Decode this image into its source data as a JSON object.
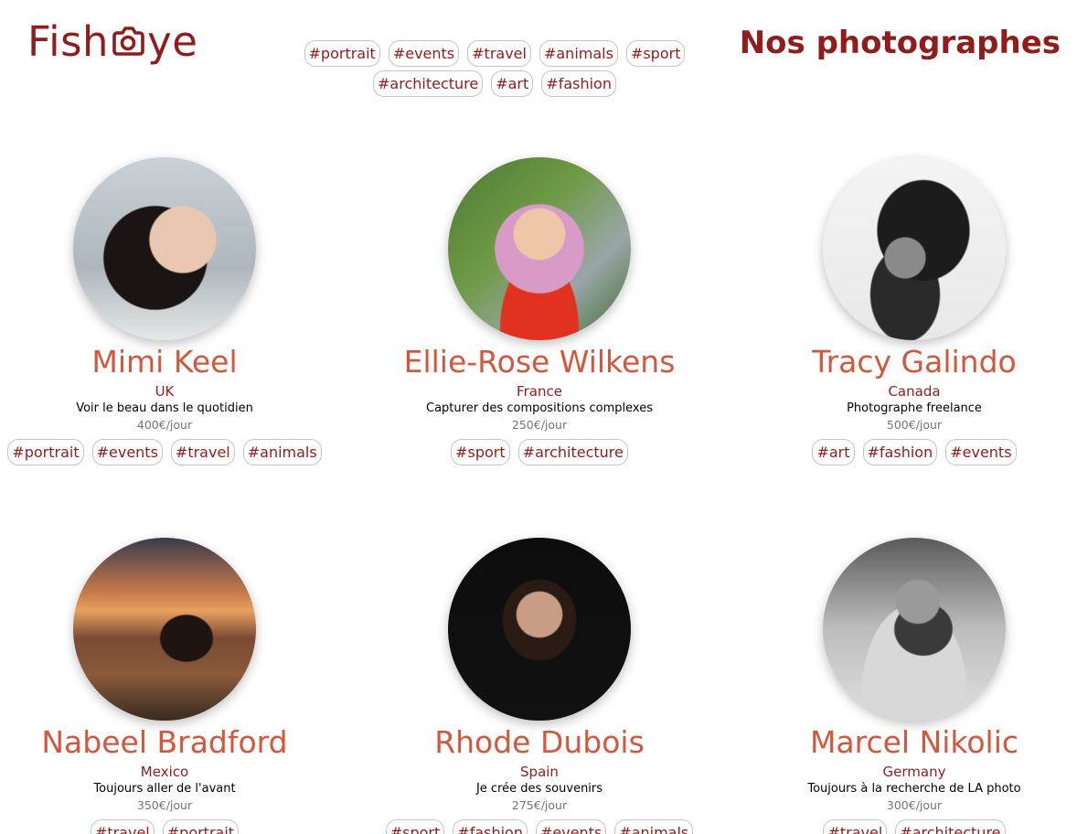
{
  "header": {
    "logo_left": "Fish",
    "logo_right": "ye",
    "title": "Nos photographes"
  },
  "nav_tags": [
    "#portrait",
    "#events",
    "#travel",
    "#animals",
    "#sport",
    "#architecture",
    "#art",
    "#fashion"
  ],
  "colors": {
    "brand_dark_red": "#901C1C",
    "name_orange": "#D3573C",
    "price_gray": "#757575",
    "tag_border": "#c4c4c4"
  },
  "photographers": [
    {
      "name": "Mimi Keel",
      "country": "UK",
      "tagline": "Voir le beau dans le quotidien",
      "price": "400€/jour",
      "tags": [
        "#portrait",
        "#events",
        "#travel",
        "#animals"
      ]
    },
    {
      "name": "Ellie-Rose Wilkens",
      "country": "France",
      "tagline": "Capturer des compositions complexes",
      "price": "250€/jour",
      "tags": [
        "#sport",
        "#architecture"
      ]
    },
    {
      "name": "Tracy Galindo",
      "country": "Canada",
      "tagline": "Photographe freelance",
      "price": "500€/jour",
      "tags": [
        "#art",
        "#fashion",
        "#events"
      ]
    },
    {
      "name": "Nabeel Bradford",
      "country": "Mexico",
      "tagline": "Toujours aller de l'avant",
      "price": "350€/jour",
      "tags": [
        "#travel",
        "#portrait"
      ]
    },
    {
      "name": "Rhode Dubois",
      "country": "Spain",
      "tagline": "Je crée des souvenirs",
      "price": "275€/jour",
      "tags": [
        "#sport",
        "#fashion",
        "#events",
        "#animals"
      ]
    },
    {
      "name": "Marcel Nikolic",
      "country": "Germany",
      "tagline": "Toujours à la recherche de LA photo",
      "price": "300€/jour",
      "tags": [
        "#travel",
        "#architecture"
      ]
    }
  ]
}
